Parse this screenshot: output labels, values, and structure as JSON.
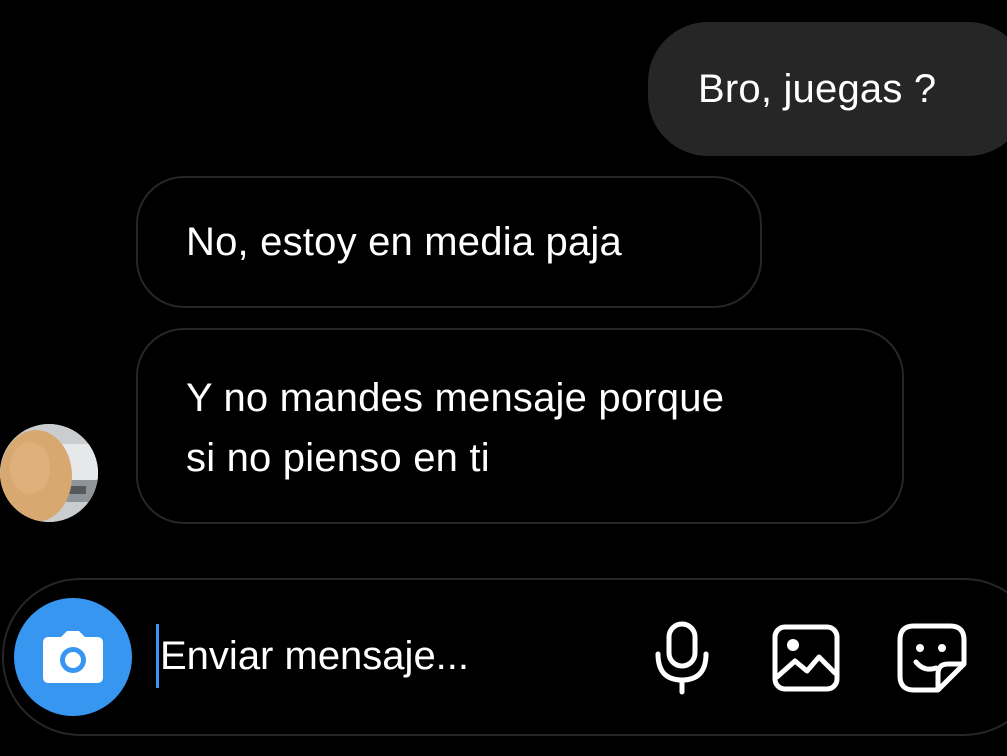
{
  "conversation": {
    "messages": [
      {
        "direction": "sent",
        "lines": [
          "Bro, juegas ?"
        ]
      },
      {
        "direction": "received",
        "lines": [
          "No, estoy en media paja"
        ]
      },
      {
        "direction": "received",
        "lines": [
          "Y no mandes mensaje porque",
          "si no pienso en ti"
        ]
      }
    ]
  },
  "composer": {
    "placeholder": "Enviar mensaje...",
    "value": "",
    "icons": [
      "camera-icon",
      "microphone-icon",
      "gallery-icon",
      "sticker-icon"
    ]
  },
  "colors": {
    "background": "#000000",
    "sent_bubble": "#262626",
    "received_border": "#262626",
    "accent": "#3797f0",
    "text": "#ffffff"
  }
}
